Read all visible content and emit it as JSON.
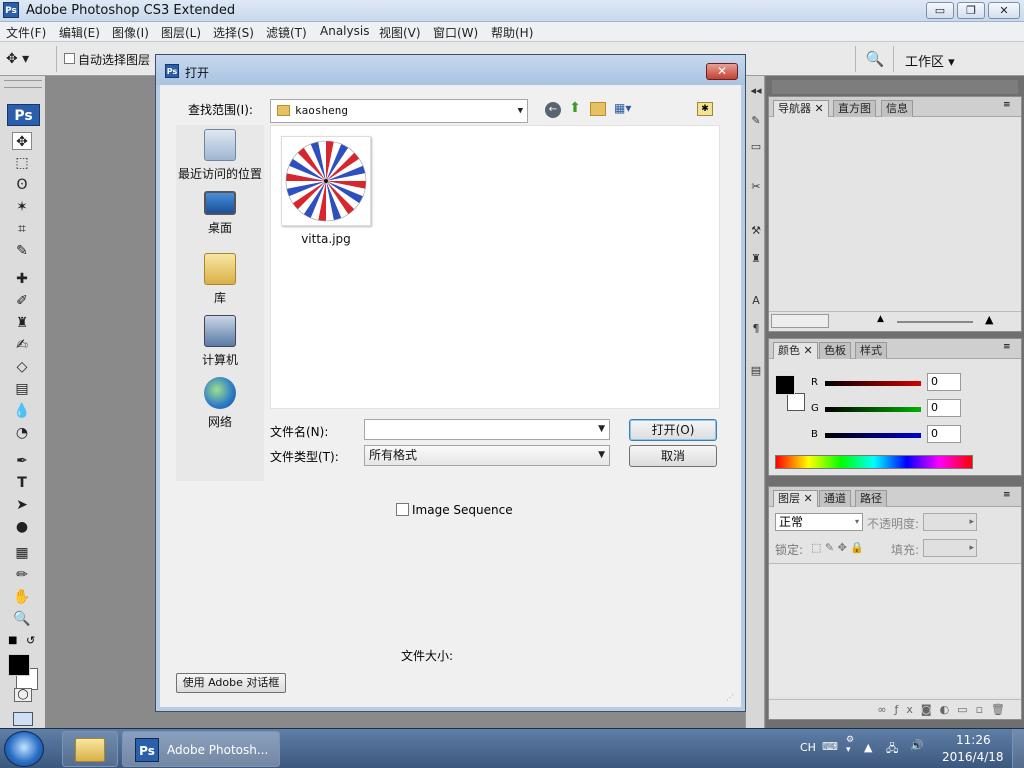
{
  "app": {
    "title": "Adobe Photoshop CS3 Extended",
    "icon_text": "Ps"
  },
  "window_buttons": {
    "minimize": "▭",
    "restore": "❐",
    "close": "✕"
  },
  "menu": [
    "文件(F)",
    "编辑(E)",
    "图像(I)",
    "图层(L)",
    "选择(S)",
    "滤镜(T)",
    "Analysis",
    "视图(V)",
    "窗口(W)",
    "帮助(H)"
  ],
  "options_bar": {
    "auto_select_label": "自动选择图层",
    "workspace_label": "工作区 ▾"
  },
  "toolbox": {
    "logo": "Ps"
  },
  "dialog": {
    "title": "打开",
    "look_in_label": "查找范围(I):",
    "look_in_value": "kaosheng",
    "places": [
      "最近访问的位置",
      "桌面",
      "库",
      "计算机",
      "网络"
    ],
    "files": [
      {
        "name": "vitta.jpg"
      }
    ],
    "filename_label": "文件名(N):",
    "filename_value": "",
    "filetype_label": "文件类型(T):",
    "filetype_value": "所有格式",
    "open_button": "打开(O)",
    "cancel_button": "取消",
    "image_sequence_label": "Image Sequence",
    "filesize_label": "文件大小:",
    "adobe_dialog_button": "使用 Adobe 对话框"
  },
  "panels": {
    "navigator_tabs": [
      "导航器",
      "直方图",
      "信息"
    ],
    "color_tabs": [
      "颜色",
      "色板",
      "样式"
    ],
    "color_channels": [
      {
        "label": "R",
        "value": "0"
      },
      {
        "label": "G",
        "value": "0"
      },
      {
        "label": "B",
        "value": "0"
      }
    ],
    "layers_tabs": [
      "图层",
      "通道",
      "路径"
    ],
    "blend_mode": "正常",
    "opacity_label": "不透明度:",
    "lock_label": "锁定:",
    "fill_label": "填充:"
  },
  "taskbar": {
    "ps_button": "Adobe Photosh...",
    "ime": "CH",
    "time": "11:26",
    "date": "2016/4/18"
  },
  "colors": {
    "ps_blue": "#2b5faa",
    "red_slider": "#d00000",
    "green_slider": "#00b000",
    "blue_slider": "#0000d0"
  }
}
